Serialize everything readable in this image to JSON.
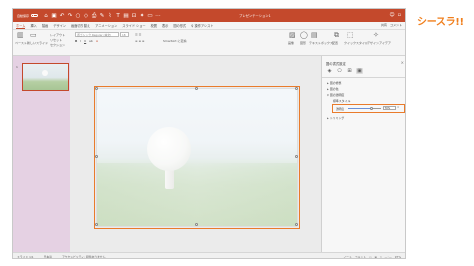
{
  "window": {
    "title": "プレゼンテーション1",
    "autosave_label": "自動保存",
    "toggle_label": "オフ"
  },
  "tabs": [
    "ホーム",
    "挿入",
    "描画",
    "デザイン",
    "画面切り替え",
    "アニメーション",
    "スライド ショー",
    "校閲",
    "表示",
    "図の形式"
  ],
  "tab_active_index": 0,
  "tell_me": "操作アシスト",
  "share": {
    "share": "共有",
    "comment": "コメント"
  },
  "ribbon": {
    "paste": "ペースト",
    "new_slide": "新しいスライド",
    "layout": "レイアウト",
    "reset": "リセット",
    "section": "セクション",
    "font_name": "游ゴシック Regular (本文)",
    "font_size": "18",
    "convert_smartart": "SmartArt に変換",
    "picture": "画像",
    "shapes": "図形",
    "textbox": "テキストボックス",
    "arrange": "配置",
    "quick_styles": "クイックスタイル",
    "design_ideas": "デザインアイデア"
  },
  "thumbnail_pane": {
    "slide_number": "1"
  },
  "status": {
    "slide_info": "スライド 1/1",
    "language": "日本語",
    "accessibility": "アクセシビリティ: 問題ありません",
    "notes": "ノート",
    "comments": "コメント",
    "zoom": "97%"
  },
  "format_pane": {
    "title": "図の書式設定",
    "sections": [
      {
        "label": "図の修整",
        "expanded": false
      },
      {
        "label": "図の色",
        "expanded": false
      },
      {
        "label": "図の透明度",
        "expanded": true
      }
    ],
    "preset_label": "標準スタイル",
    "transparency_label": "透明度",
    "transparency_value": "70%",
    "transparency_level": 0.7,
    "crop_label": "トリミング"
  },
  "brand": {
    "text": "シースラ!!",
    "color": "#f07f1d"
  },
  "colors": {
    "accent": "#c4492c",
    "highlight": "#e97b2b",
    "thumb_bg": "#e5d1e3"
  }
}
